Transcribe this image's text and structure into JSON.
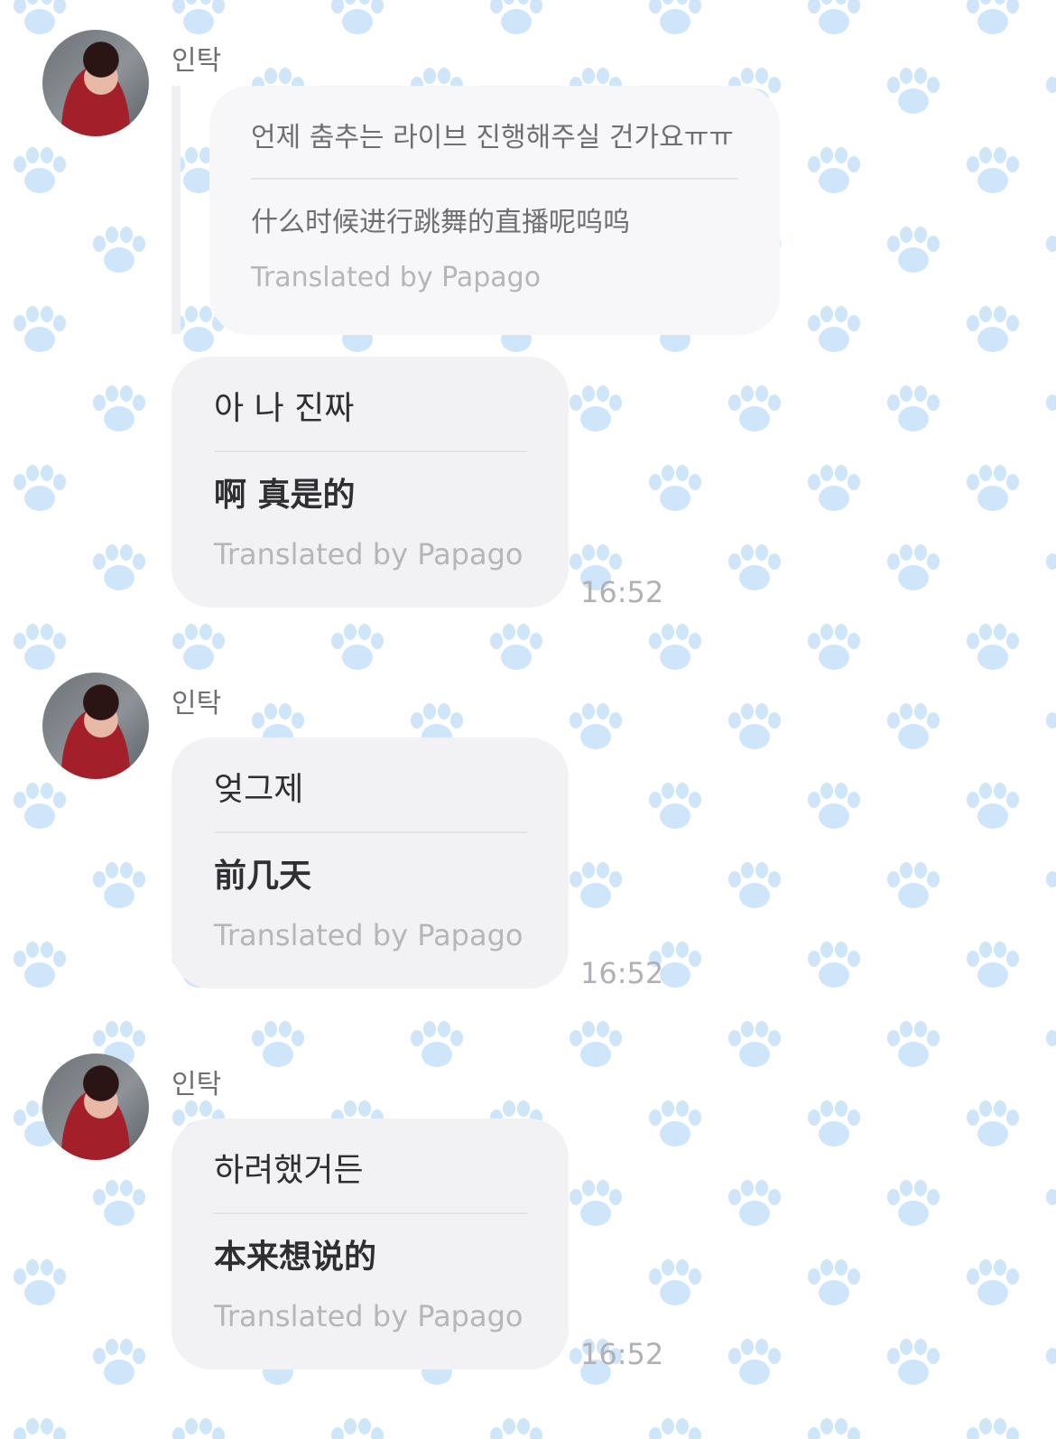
{
  "theme": {
    "background": "#ffffff",
    "paw_color": "#cfe5fa",
    "bubble_color": "#f2f2f5"
  },
  "messages": [
    {
      "sender": "인탁",
      "reply_quote": {
        "original": "언제 춤추는 라이브 진행해주실 건가요ㅠㅠ",
        "translated": "什么时候进行跳舞的直播呢呜呜",
        "credit": "Translated by Papago"
      },
      "original": "아 나 진짜",
      "translated": "啊 真是的",
      "credit": "Translated by Papago",
      "time": "16:52"
    },
    {
      "sender": "인탁",
      "original": "엊그제",
      "translated": "前几天",
      "credit": "Translated by Papago",
      "time": "16:52"
    },
    {
      "sender": "인탁",
      "original": "하려했거든",
      "translated": "本来想说的",
      "credit": "Translated by Papago",
      "time": "16:52"
    }
  ]
}
